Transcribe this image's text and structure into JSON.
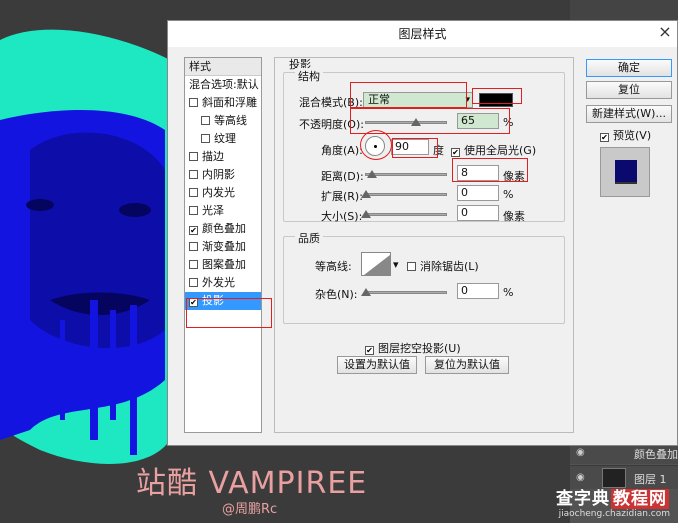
{
  "dialog": {
    "title": "图层样式",
    "close": "×"
  },
  "styles_list": {
    "header": "样式",
    "items": [
      {
        "label": "混合选项:默认",
        "checked": null
      },
      {
        "label": "斜面和浮雕",
        "checked": false
      },
      {
        "label": "等高线",
        "checked": false,
        "indent": true
      },
      {
        "label": "纹理",
        "checked": false,
        "indent": true
      },
      {
        "label": "描边",
        "checked": false
      },
      {
        "label": "内阴影",
        "checked": false
      },
      {
        "label": "内发光",
        "checked": false
      },
      {
        "label": "光泽",
        "checked": false
      },
      {
        "label": "颜色叠加",
        "checked": true
      },
      {
        "label": "渐变叠加",
        "checked": false
      },
      {
        "label": "图案叠加",
        "checked": false
      },
      {
        "label": "外发光",
        "checked": false
      },
      {
        "label": "投影",
        "checked": true,
        "selected": true
      }
    ]
  },
  "drop_shadow": {
    "section_title": "投影",
    "structure_title": "结构",
    "blend_mode_label": "混合模式(B):",
    "blend_mode_value": "正常",
    "opacity_label": "不透明度(O):",
    "opacity_value": "65",
    "opacity_unit": "%",
    "angle_label": "角度(A):",
    "angle_value": "90",
    "angle_unit": "度",
    "global_light_label": "使用全局光(G)",
    "global_light_checked": true,
    "distance_label": "距离(D):",
    "distance_value": "8",
    "distance_unit": "像素",
    "spread_label": "扩展(R):",
    "spread_value": "0",
    "spread_unit": "%",
    "size_label": "大小(S):",
    "size_value": "0",
    "size_unit": "像素",
    "quality_title": "品质",
    "contour_label": "等高线:",
    "antialias_label": "消除锯齿(L)",
    "antialias_checked": false,
    "noise_label": "杂色(N):",
    "noise_value": "0",
    "noise_unit": "%",
    "knockout_label": "图层挖空投影(U)",
    "knockout_checked": true,
    "make_default_label": "设置为默认值",
    "reset_default_label": "复位为默认值",
    "shadow_color": "#000000"
  },
  "buttons": {
    "ok": "确定",
    "reset": "复位",
    "new_style": "新建样式(W)...",
    "preview_label": "预览(V)",
    "preview_checked": true
  },
  "layers": [
    {
      "name": "颜色叠加"
    },
    {
      "name": "图层 1"
    }
  ],
  "watermark": {
    "title": "站酷 VAMPIREE",
    "author": "@周鹏Rc"
  },
  "site_logo": {
    "name_a": "查字典",
    "name_b": "教程网",
    "url": "jiaocheng.chazidian.com"
  },
  "colors": {
    "teal": "#1ee8c2",
    "blue_overlay": "#1414e0",
    "annotation_red": "#e02020"
  }
}
